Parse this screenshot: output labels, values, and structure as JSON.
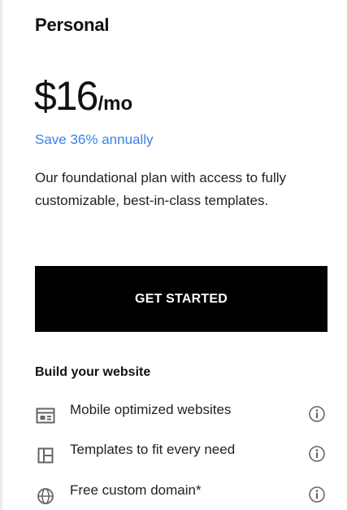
{
  "plan": {
    "name": "Personal",
    "price_amount": "$16",
    "price_period": "/mo",
    "savings_text": "Save 36% annually",
    "description": "Our foundational plan with access to fully customizable, best-in-class templates.",
    "cta_label": "GET STARTED"
  },
  "features": {
    "section_title": "Build your website",
    "items": [
      {
        "label": "Mobile optimized websites",
        "icon": "browser-window-icon"
      },
      {
        "label": "Templates to fit every need",
        "icon": "layout-template-icon"
      },
      {
        "label": "Free custom domain*",
        "icon": "globe-icon"
      }
    ]
  },
  "colors": {
    "accent": "#3b82e6",
    "button_bg": "#000000",
    "button_text": "#ffffff",
    "icon_gray": "#666666"
  }
}
